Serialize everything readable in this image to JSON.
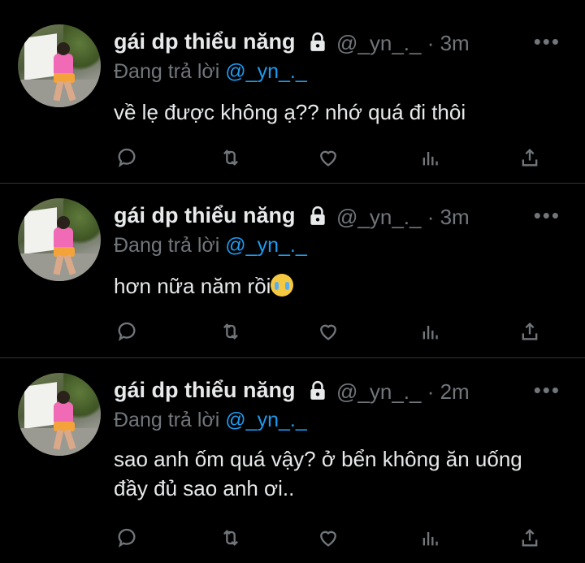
{
  "tweets": [
    {
      "author_name": "gái dp thiểu năng",
      "handle": "@_yn_._",
      "time": "· 3m",
      "reply_prefix": "Đang trả lời ",
      "reply_mention": "@_yn_._",
      "text": "về lẹ được không ạ?? nhớ quá đi thôi",
      "text_line2": ""
    },
    {
      "author_name": "gái dp thiểu năng",
      "handle": "@_yn_._",
      "time": "· 3m",
      "reply_prefix": "Đang trả lời ",
      "reply_mention": "@_yn_._",
      "text": "hơn nữa năm rồi",
      "emoji": "loudly-crying-face-emoji"
    },
    {
      "author_name": "gái dp thiểu năng",
      "handle": "@_yn_._",
      "time": "· 2m",
      "reply_prefix": "Đang trả lời ",
      "reply_mention": "@_yn_._",
      "text": "sao anh ốm quá vậy? ở bển không ăn uống",
      "text_line2": "đầy đủ sao anh ơi.."
    }
  ],
  "more_label": "•••",
  "colors": {
    "background": "#000000",
    "text": "#e7e9ea",
    "muted": "#71767b",
    "mention": "#1d9bf0",
    "divider": "#2f3336"
  },
  "icons": [
    "reply-icon",
    "retweet-icon",
    "like-icon",
    "views-icon",
    "share-icon",
    "lock-icon",
    "more-icon"
  ]
}
